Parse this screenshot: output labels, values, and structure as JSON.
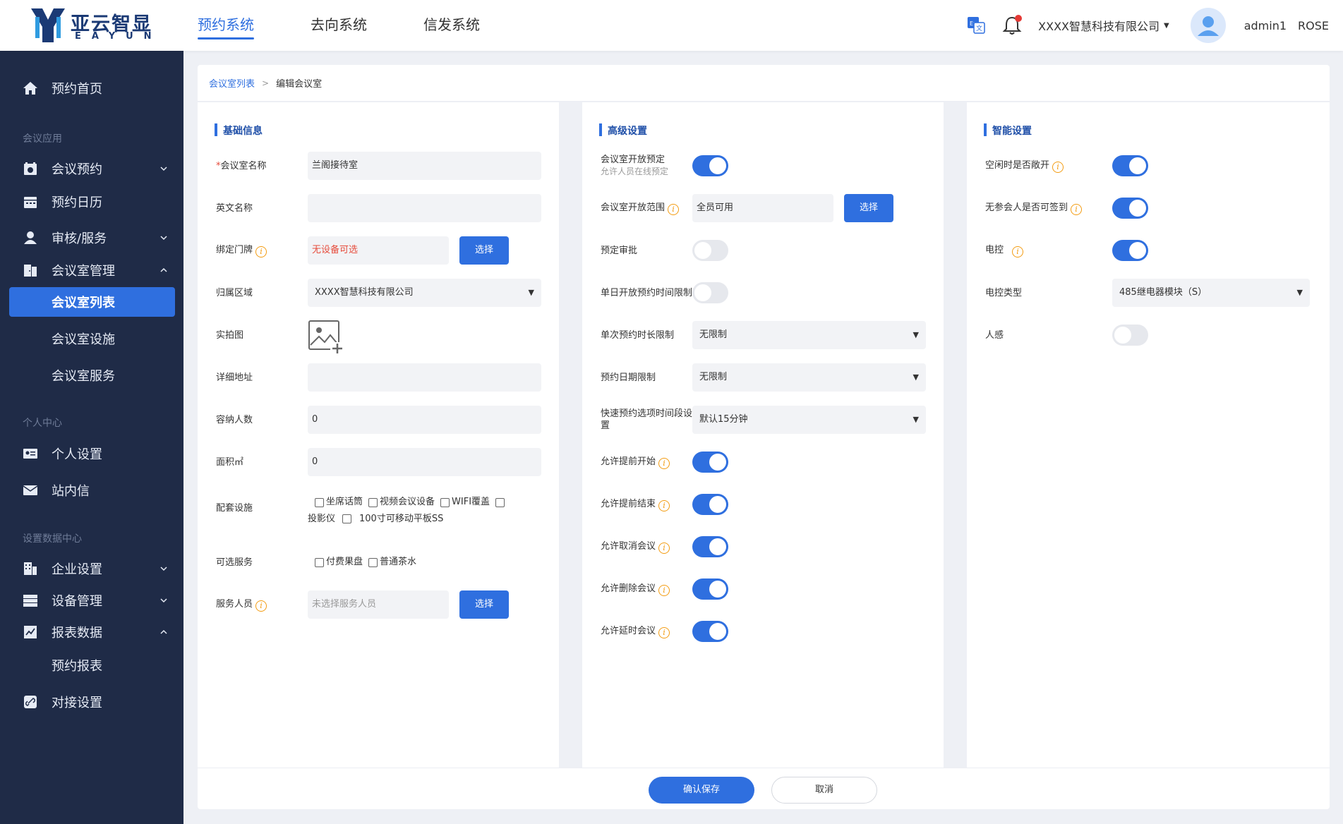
{
  "header": {
    "logo_cn": "亚云智显",
    "logo_en": "EAYUN",
    "nav": [
      "预约系统",
      "去向系统",
      "信发系统"
    ],
    "company": "XXXX智慧科技有限公司",
    "username": "admin1",
    "role": "ROSE"
  },
  "sidebar": {
    "home": "预约首页",
    "group1": "会议应用",
    "meeting_booking": "会议预约",
    "booking_calendar": "预约日历",
    "review_service": "审核/服务",
    "room_mgmt": "会议室管理",
    "room_list": "会议室列表",
    "room_facility": "会议室设施",
    "room_service": "会议室服务",
    "group2": "个人中心",
    "personal_settings": "个人设置",
    "inbox": "站内信",
    "group3": "设置数据中心",
    "enterprise_settings": "企业设置",
    "device_mgmt": "设备管理",
    "report_data": "报表数据",
    "booking_report": "预约报表",
    "integration_settings": "对接设置"
  },
  "breadcrumb": {
    "parent": "会议室列表",
    "current": "编辑会议室"
  },
  "basic": {
    "title": "基础信息",
    "name_label": "会议室名称",
    "name_value": "兰阁接待室",
    "en_name_label": "英文名称",
    "en_name_value": "",
    "doorplate_label": "绑定门牌",
    "doorplate_value": "无设备可选",
    "select_label": "选择",
    "area_label": "归属区域",
    "area_value": "XXXX智慧科技有限公司",
    "photo_label": "实拍图",
    "address_label": "详细地址",
    "address_value": "",
    "capacity_label": "容纳人数",
    "capacity_value": "0",
    "size_label": "面积㎡",
    "size_value": "0",
    "facilities_label": "配套设施",
    "facilities": [
      "坐席话筒",
      "视频会议设备",
      "WIFI覆盖",
      "投影仪",
      "100寸可移动平板SS"
    ],
    "services_label": "可选服务",
    "services": [
      "付费果盘",
      "普通茶水"
    ],
    "staff_label": "服务人员",
    "staff_placeholder": "未选择服务人员"
  },
  "advanced": {
    "title": "高级设置",
    "open_booking_label": "会议室开放预定",
    "open_booking_sub": "允许人员在线预定",
    "open_booking_on": true,
    "open_scope_label": "会议室开放范围",
    "open_scope_value": "全员可用",
    "select_label": "选择",
    "approval_label": "预定审批",
    "approval_on": false,
    "daily_limit_label": "单日开放预约时间限制",
    "daily_limit_on": false,
    "duration_limit_label": "单次预约时长限制",
    "duration_limit_value": "无限制",
    "date_limit_label": "预约日期限制",
    "date_limit_value": "无限制",
    "quick_interval_label": "快速预约选项时间段设置",
    "quick_interval_value": "默认15分钟",
    "early_start_label": "允许提前开始",
    "early_end_label": "允许提前结束",
    "cancel_label": "允许取消会议",
    "delete_label": "允许删除会议",
    "extend_label": "允许延时会议"
  },
  "smart": {
    "title": "智能设置",
    "idle_label": "空闲时是否敞开",
    "idle_on": true,
    "checkin_label": "无参会人是否可签到",
    "checkin_on": true,
    "power_label": "电控",
    "power_on": true,
    "power_type_label": "电控类型",
    "power_type_value": "485继电器模块（S）",
    "sensor_label": "人感",
    "sensor_on": false
  },
  "footer": {
    "save": "确认保存",
    "cancel": "取消"
  },
  "colors": {
    "primary": "#2f6fdf",
    "sidebar_bg": "#1f2b47",
    "danger": "#e74c3c",
    "info": "#f39c12"
  }
}
